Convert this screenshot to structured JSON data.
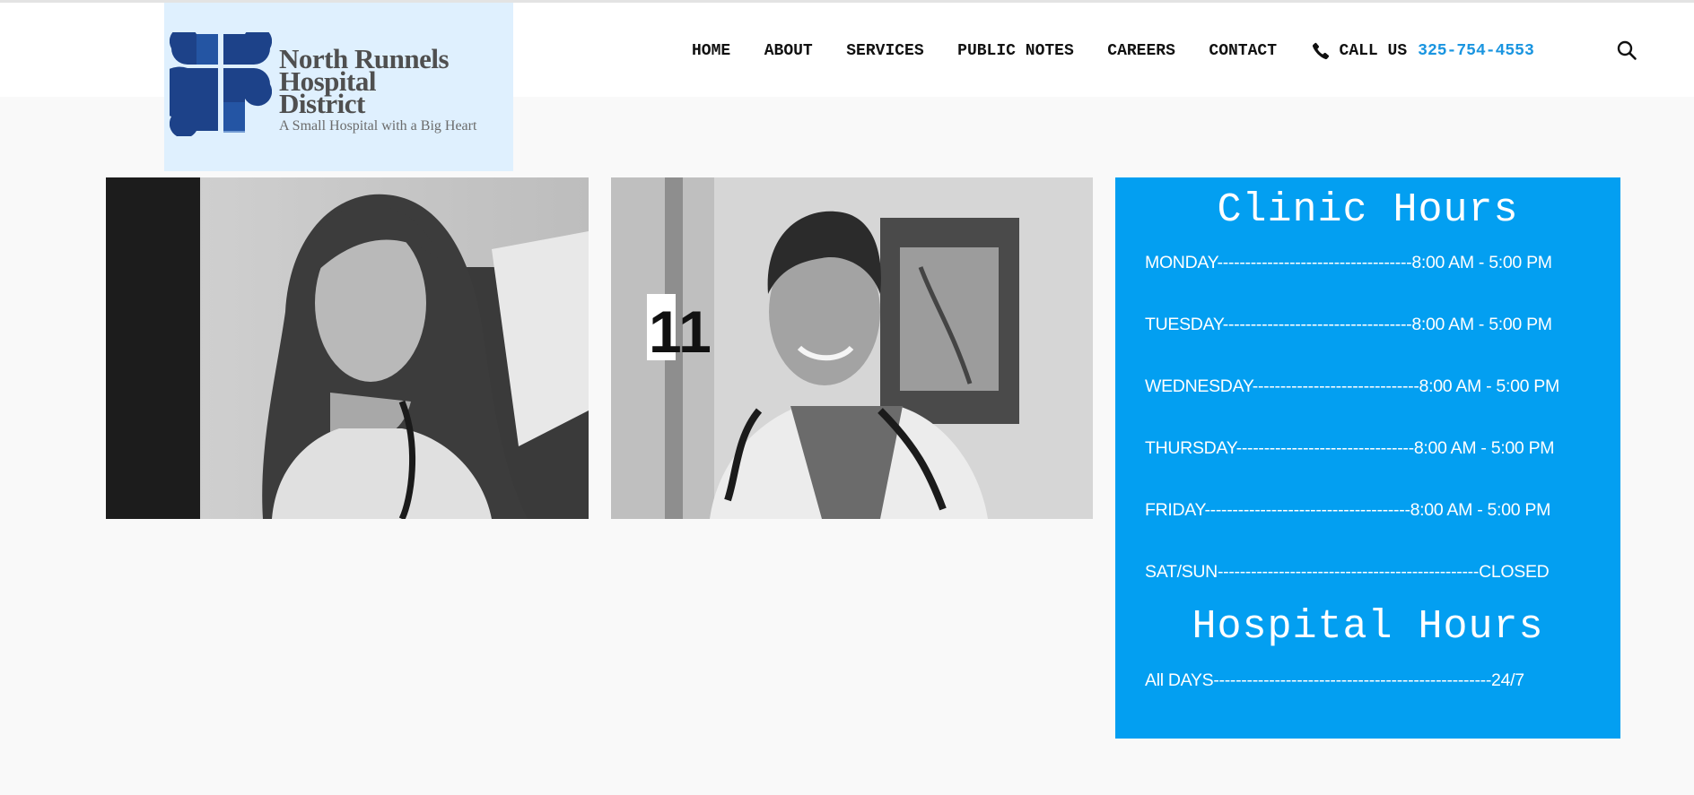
{
  "brand": {
    "name_line1": "North Runnels",
    "name_line2": "Hospital",
    "name_line3": "District",
    "tagline": "A Small Hospital with a Big Heart",
    "logo_color": "#1d4289"
  },
  "nav": {
    "items": [
      "HOME",
      "ABOUT",
      "SERVICES",
      "PUBLIC NOTES",
      "CAREERS",
      "CONTACT"
    ],
    "call_label": "CALL US",
    "call_number": "325-754-4553",
    "accent": "#1a95e0"
  },
  "clinic": {
    "title": "Clinic Hours",
    "rows": [
      "MONDAY-----------------------------------8:00 AM - 5:00 PM",
      "TUESDAY----------------------------------8:00 AM - 5:00 PM",
      "WEDNESDAY------------------------------8:00 AM - 5:00 PM",
      "THURSDAY--------------------------------8:00 AM - 5:00 PM",
      "FRIDAY-------------------------------------8:00 AM - 5:00 PM",
      "SAT/SUN-----------------------------------------------CLOSED"
    ]
  },
  "hospital": {
    "title": "Hospital Hours",
    "rows": [
      "All DAYS--------------------------------------------------24/7"
    ]
  },
  "colors": {
    "panel": "#039ff1",
    "logo_bg": "#dff0fe"
  }
}
